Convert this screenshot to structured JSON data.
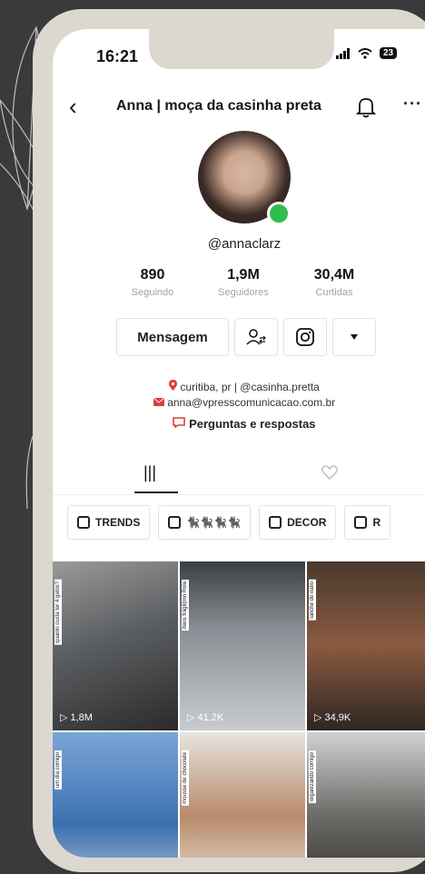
{
  "status": {
    "time": "16:21",
    "battery": "23"
  },
  "header": {
    "title": "Anna | moça da casinha preta"
  },
  "profile": {
    "username": "@annaclarz",
    "stats": [
      {
        "value": "890",
        "label": "Seguindo"
      },
      {
        "value": "1,9M",
        "label": "Seguidores"
      },
      {
        "value": "30,4M",
        "label": "Curtidas"
      }
    ],
    "message_button": "Mensagem",
    "bio_line1": "curitiba, pr | @casinha.pretta",
    "bio_line2": "anna@vpresscomunicacao.com.br",
    "qa_link": "Perguntas e respostas"
  },
  "playlists": [
    "TRENDS",
    "🐈‍⬛🐈‍⬛🐈‍⬛🐈‍⬛",
    "DECOR",
    "R"
  ],
  "videos": [
    {
      "views": "1,8M",
      "caption": "quanto custa ter 4 gatos?"
    },
    {
      "views": "41,2K",
      "caption": "itens frágil(rnn Rola"
    },
    {
      "views": "34,9K",
      "caption": "lanche do natio"
    },
    {
      "views": "",
      "caption": "um dia comigo"
    },
    {
      "views": "",
      "caption": "mousse de chocolate"
    },
    {
      "views": "",
      "caption": "organizando comigo"
    }
  ],
  "colors": {
    "background": "#3a3a3a",
    "phone_frame": "#dcd8d0",
    "online": "#2fbd4c"
  }
}
